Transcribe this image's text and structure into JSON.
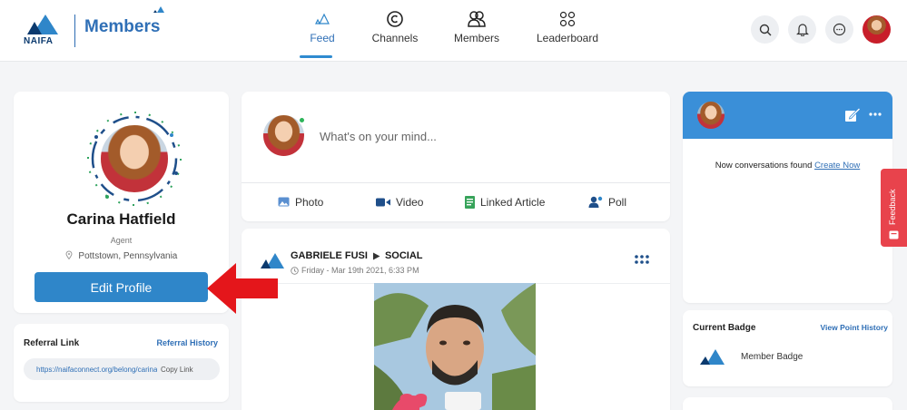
{
  "header": {
    "logo_org": "NAIFA",
    "logo_product": "Members",
    "nav": [
      {
        "label": "Feed",
        "icon": "feed-icon",
        "active": true
      },
      {
        "label": "Channels",
        "icon": "channels-icon"
      },
      {
        "label": "Members",
        "icon": "members-icon"
      },
      {
        "label": "Leaderboard",
        "icon": "leaderboard-icon"
      }
    ],
    "icons": [
      "search-icon",
      "bell-icon",
      "chat-icon",
      "user-avatar"
    ]
  },
  "profile": {
    "name": "Carina Hatfield",
    "role": "Agent",
    "location": "Pottstown, Pennsylvania",
    "edit_label": "Edit Profile"
  },
  "referral": {
    "title": "Referral Link",
    "history_label": "Referral History",
    "url": "https://naifaconnect.org/belong/carina",
    "copy_label": "Copy Link"
  },
  "composer": {
    "placeholder": "What's on your mind...",
    "actions": [
      {
        "label": "Photo",
        "icon": "photo-icon"
      },
      {
        "label": "Video",
        "icon": "video-icon"
      },
      {
        "label": "Linked Article",
        "icon": "article-icon"
      },
      {
        "label": "Poll",
        "icon": "poll-icon"
      }
    ]
  },
  "post": {
    "author": "GABRIELE FUSI",
    "channel": "SOCIAL",
    "time": "Friday - Mar 19th 2021, 6:33 PM"
  },
  "conversations": {
    "empty_text": "Now conversations found",
    "create_label": "Create Now"
  },
  "feedback": {
    "label": "Feedback"
  },
  "badge": {
    "title": "Current Badge",
    "history_label": "View Point History",
    "name": "Member Badge"
  },
  "colors": {
    "brand_blue": "#2f86c9",
    "conv_header": "#3a8fd8",
    "feedback_red": "#e8434c",
    "online_green": "#2db45a",
    "arrow_red": "#e4161b"
  }
}
